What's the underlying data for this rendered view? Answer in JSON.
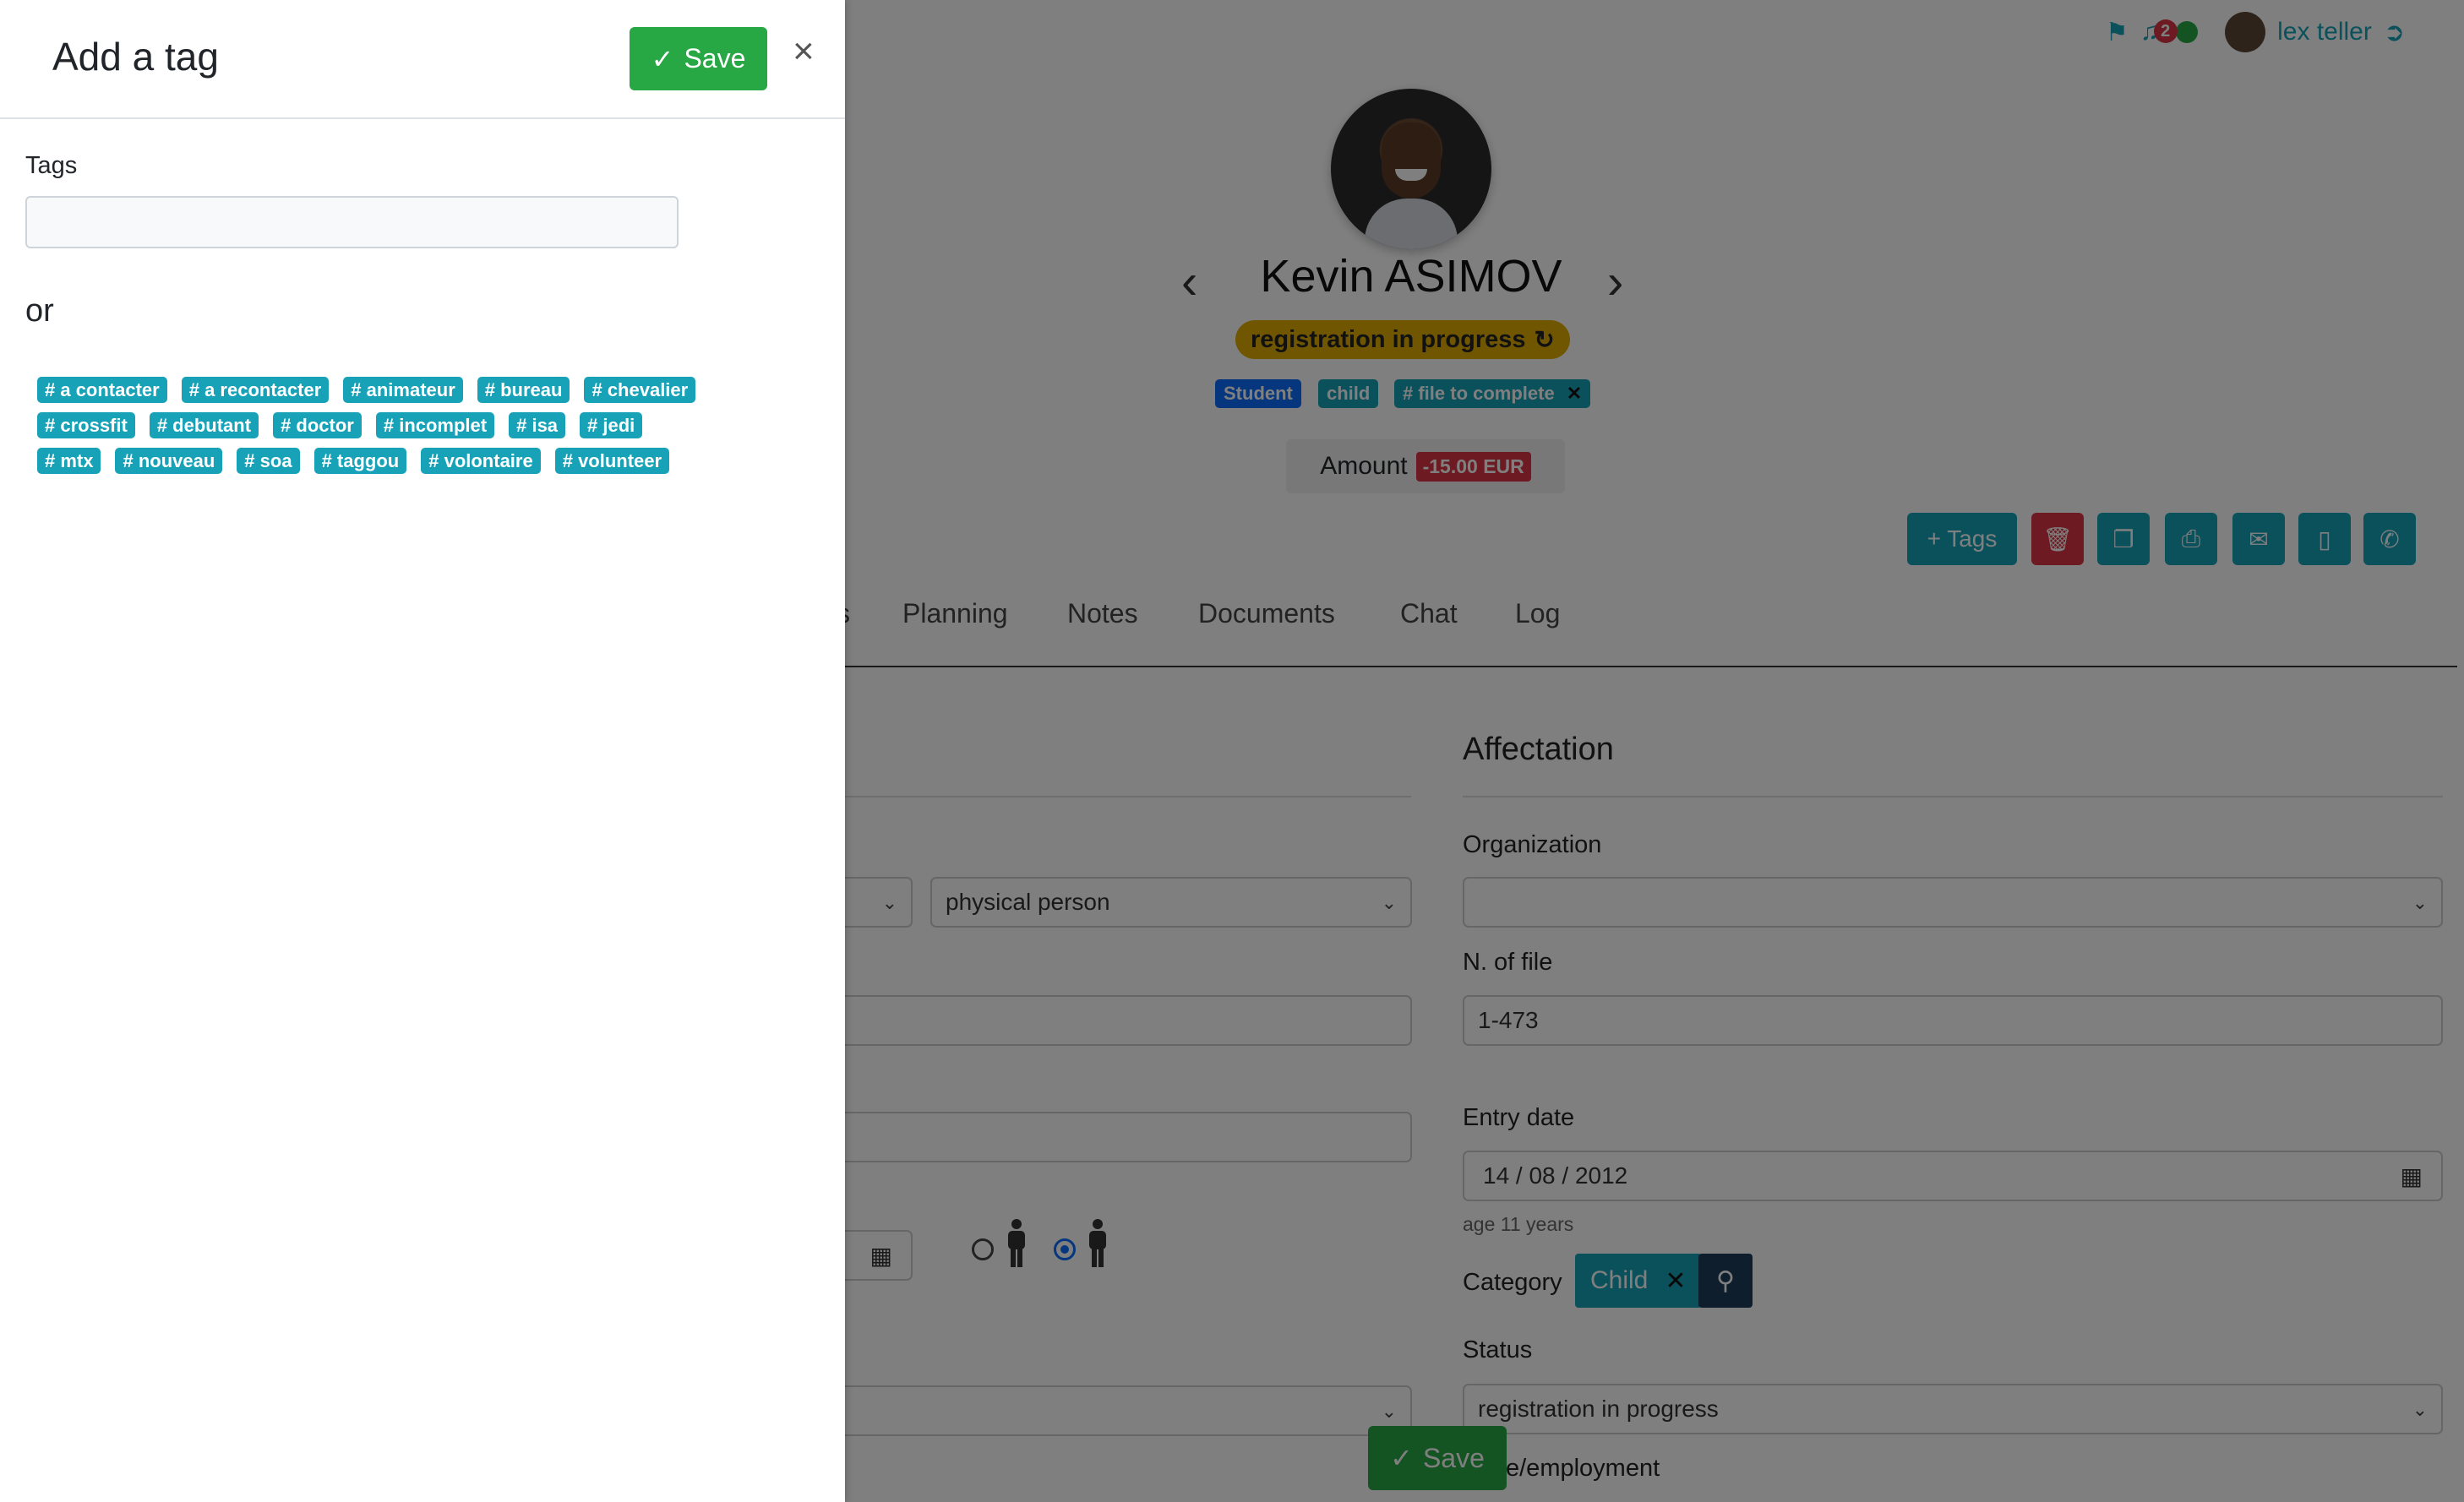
{
  "panel": {
    "title": "Add a tag",
    "save_label": "Save",
    "close_label": "×",
    "tags_label": "Tags",
    "tags_input_value": "",
    "or_label": "or",
    "tag_rows": [
      [
        "# a contacter",
        "# a recontacter",
        "# animateur",
        "# bureau",
        "# chevalier"
      ],
      [
        "# crossfit",
        "# debutant",
        "# doctor",
        "# incomplet",
        "# isa",
        "# jedi"
      ],
      [
        "# mtx",
        "# nouveau",
        "# soa",
        "# taggou",
        "# volontaire",
        "# volunteer"
      ]
    ]
  },
  "header": {
    "notification_count": "2",
    "user_name": "lex teller"
  },
  "profile": {
    "name": "Kevin ASIMOV",
    "status": "registration in progress",
    "badges": [
      "Student",
      "child",
      "# file to complete"
    ],
    "amount_label": "Amount",
    "amount_value": "-15.00 EUR",
    "tags_button": "+ Tags"
  },
  "tabs": [
    "s",
    "Planning",
    "Notes",
    "Documents",
    "Chat",
    "Log"
  ],
  "form": {
    "person_type": "physical person",
    "affectation_title": "Affectation",
    "organization_label": "Organization",
    "organization_value": "",
    "file_no_label": "N. of file",
    "file_no_value": "1-473",
    "entry_date_label": "Entry date",
    "entry_date_value": "14 / 08 / 2012",
    "age_text": "age 11 years",
    "category_label": "Category",
    "category_value": "Child",
    "status_label": "Status",
    "status_value": "registration in progress",
    "employment_label": "e/employment",
    "save_label": "Save"
  },
  "colors": {
    "success": "#28a745",
    "info": "#17a2b8",
    "danger": "#dc3545",
    "warning": "#e1ad01",
    "primary": "#0d6efd"
  }
}
